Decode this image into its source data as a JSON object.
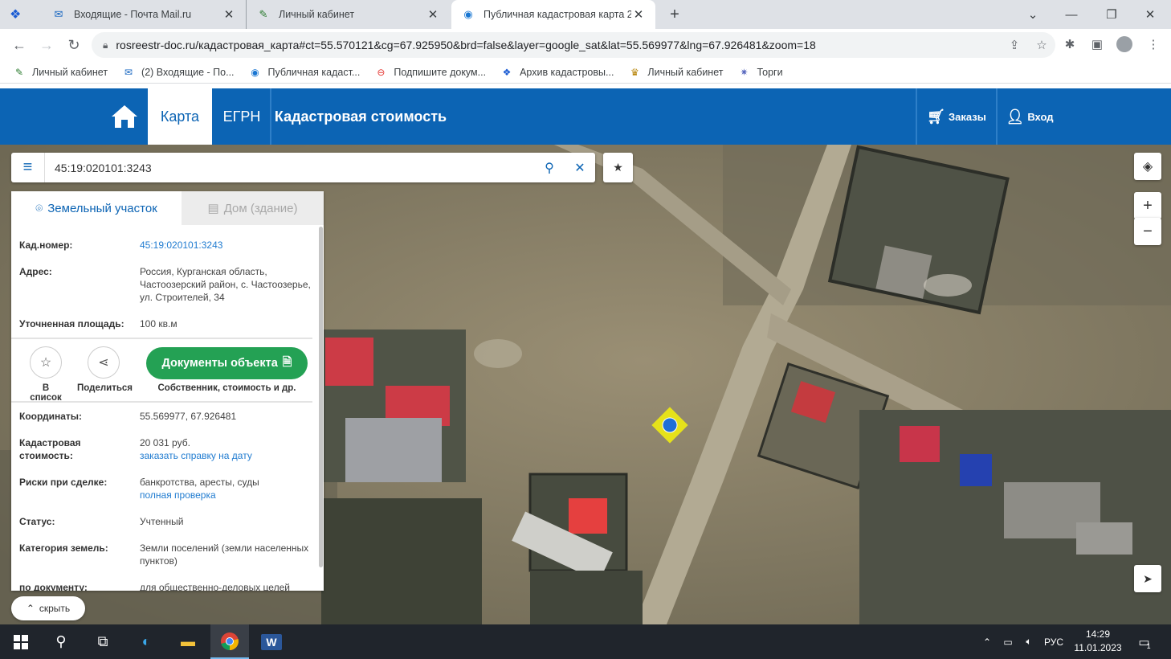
{
  "browser": {
    "tabs": [
      {
        "title": "Входящие - Почта Mail.ru",
        "icon": "mail-icon"
      },
      {
        "title": "Личный кабинет",
        "icon": "pin-icon"
      },
      {
        "title": "Публичная кадастровая карта 2",
        "icon": "rosreestr-icon"
      }
    ],
    "url": "rosreestr-doc.ru/кадастровая_карта#ct=55.570121&cg=67.925950&brd=false&layer=google_sat&lat=55.569977&lng=67.926481&zoom=18",
    "bookmarks": [
      {
        "label": "Личный кабинет",
        "color": "#2e7d32"
      },
      {
        "label": "(2) Входящие - По...",
        "color": "#1565c0"
      },
      {
        "label": "Публичная кадаст...",
        "color": "#1976d2"
      },
      {
        "label": "Подпишите докум...",
        "color": "#e53935"
      },
      {
        "label": "Архив кадастровы...",
        "color": "#1a5bd3"
      },
      {
        "label": "Личный кабинет",
        "color": "#b8860b"
      },
      {
        "label": "Торги",
        "color": "#5c6bc0"
      }
    ]
  },
  "site": {
    "nav": [
      "Карта",
      "ЕГРН",
      "Кадастровая стоимость"
    ],
    "orders": "Заказы",
    "login": "Вход"
  },
  "search": {
    "value": "45:19:020101:3243"
  },
  "panel": {
    "tabs": {
      "land": "Земельный участок",
      "building": "Дом (здание)"
    },
    "cad_number": {
      "label": "Кад.номер:",
      "value": "45:19:020101:3243"
    },
    "address": {
      "label": "Адрес:",
      "value": "Россия, Курганская область, Частоозерский район, с. Частоозерье, ул. Строителей, 34"
    },
    "area": {
      "label": "Уточненная площадь:",
      "value": "100 кв.м"
    },
    "actions": {
      "list": "В список",
      "share": "Поделиться",
      "docs": "Документы объекта",
      "docs_sub": "Собственник, стоимость и др."
    },
    "coords": {
      "label": "Координаты:",
      "value": "55.569977, 67.926481"
    },
    "cost": {
      "label": "Кадастровая стоимость:",
      "value": "20 031 руб.",
      "link": "заказать справку на дату"
    },
    "risks": {
      "label": "Риски при сделке:",
      "value": "банкротства, аресты, суды",
      "link": "полная проверка"
    },
    "status": {
      "label": "Статус:",
      "value": "Учтенный"
    },
    "category": {
      "label": "Категория земель:",
      "value": "Земли поселений (земли населенных пунктов)"
    },
    "by_doc": {
      "label": "по документу:",
      "value": "для общественно-деловых целей"
    },
    "hide": "скрыть"
  },
  "map": {
    "zoom_in": "+",
    "zoom_out": "−"
  },
  "taskbar": {
    "lang": "РУС",
    "time": "14:29",
    "date": "11.01.2023",
    "notif_count": "1"
  }
}
